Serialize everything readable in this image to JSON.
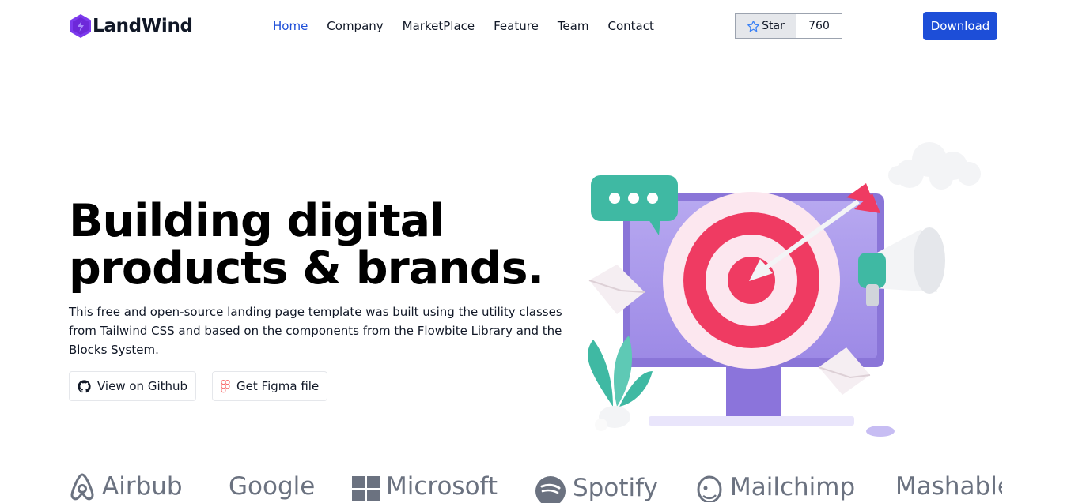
{
  "brand": {
    "name": "LandWind",
    "icon": "hexagon-bolt-icon",
    "color": "#7c3aed"
  },
  "nav": {
    "items": [
      {
        "label": "Home",
        "active": true
      },
      {
        "label": "Company",
        "active": false
      },
      {
        "label": "MarketPlace",
        "active": false
      },
      {
        "label": "Feature",
        "active": false
      },
      {
        "label": "Team",
        "active": false
      },
      {
        "label": "Contact",
        "active": false
      }
    ],
    "active_color": "#1d4ed8"
  },
  "github_star": {
    "label": "Star",
    "count": "760",
    "icon": "star-icon"
  },
  "download": {
    "label": "Download",
    "color": "#1d4ed8"
  },
  "hero": {
    "title_line1": "Building digital",
    "title_line2": "products & brands.",
    "description": "This free and open-source landing page template was built using the utility classes from Tailwind CSS and based on the components from the Flowbite Library and the Blocks System.",
    "buttons": [
      {
        "label": "View on Github",
        "icon": "github-icon"
      },
      {
        "label": "Get Figma file",
        "icon": "figma-icon"
      }
    ]
  },
  "logos": [
    {
      "label": "Airbub",
      "icon": "airbnb-icon"
    },
    {
      "label": "Google",
      "icon": ""
    },
    {
      "label": "Microsoft",
      "icon": "windows-icon"
    },
    {
      "label": "Spotify",
      "icon": "spotify-icon"
    },
    {
      "label": "Mailchimp",
      "icon": "mailchimp-icon"
    },
    {
      "label": "Mashable",
      "icon": ""
    }
  ]
}
